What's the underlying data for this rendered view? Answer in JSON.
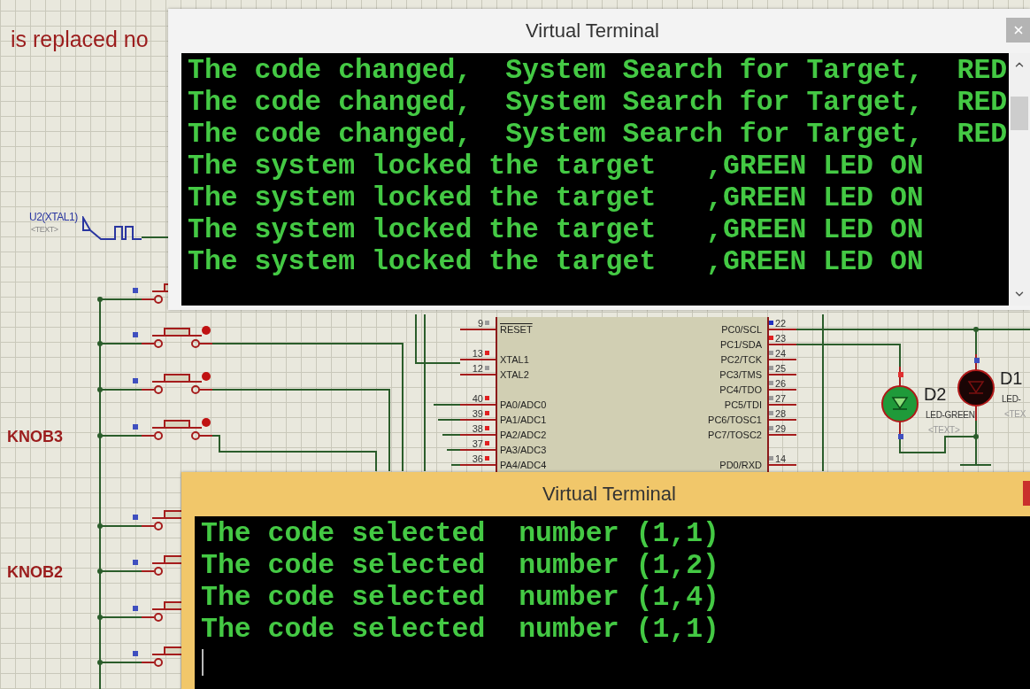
{
  "schematic": {
    "note": "is replaced no",
    "generator": {
      "label": "U2(XTAL1)",
      "text": "<TEXT>"
    },
    "switch_groups": [
      {
        "label": "KNOB3"
      },
      {
        "label": "KNOB2"
      }
    ],
    "chip": {
      "left_pins": [
        {
          "number": "9",
          "name": "RESET",
          "color": "#9a9a9a"
        },
        {
          "number": "13",
          "name": "XTAL1",
          "color": "#e02020"
        },
        {
          "number": "12",
          "name": "XTAL2",
          "color": "#9a9a9a"
        },
        {
          "number": "40",
          "name": "PA0/ADC0",
          "color": "#e02020"
        },
        {
          "number": "39",
          "name": "PA1/ADC1",
          "color": "#e02020"
        },
        {
          "number": "38",
          "name": "PA2/ADC2",
          "color": "#e02020"
        },
        {
          "number": "37",
          "name": "PA3/ADC3",
          "color": "#e02020"
        },
        {
          "number": "36",
          "name": "PA4/ADC4",
          "color": "#e02020"
        }
      ],
      "right_pins": [
        {
          "number": "22",
          "name": "PC0/SCL",
          "color": "#2030c0"
        },
        {
          "number": "23",
          "name": "PC1/SDA",
          "color": "#e02020"
        },
        {
          "number": "24",
          "name": "PC2/TCK",
          "color": "#9a9a9a"
        },
        {
          "number": "25",
          "name": "PC3/TMS",
          "color": "#9a9a9a"
        },
        {
          "number": "26",
          "name": "PC4/TDO",
          "color": "#9a9a9a"
        },
        {
          "number": "27",
          "name": "PC5/TDI",
          "color": "#9a9a9a"
        },
        {
          "number": "28",
          "name": "PC6/TOSC1",
          "color": "#9a9a9a"
        },
        {
          "number": "29",
          "name": "PC7/TOSC2",
          "color": "#9a9a9a"
        },
        {
          "number": "14",
          "name": "PD0/RXD",
          "color": "#9a9a9a"
        }
      ]
    },
    "leds": [
      {
        "ref": "D2",
        "type": "LED-GREEN",
        "text": "<TEXT>",
        "on": true
      },
      {
        "ref": "D1",
        "type": "LED-",
        "text": "<TEX",
        "on": false
      }
    ]
  },
  "terminals": [
    {
      "title": "Virtual Terminal",
      "active": false,
      "scrollbar": true,
      "cursor": false,
      "lines": [
        "The code changed,  System Search for Target,  RED",
        "The code changed,  System Search for Target,  RED",
        "The code changed,  System Search for Target,  RED",
        "The system locked the target   ,GREEN LED ON",
        "The system locked the target   ,GREEN LED ON",
        "The system locked the target   ,GREEN LED ON",
        "The system locked the target   ,GREEN LED ON"
      ]
    },
    {
      "title": "Virtual Terminal",
      "active": true,
      "scrollbar": false,
      "cursor": true,
      "lines": [
        "The code selected  number (1,1)",
        "The code selected  number (1,2)",
        "The code selected  number (1,4)",
        "The code selected  number (1,1)"
      ]
    }
  ]
}
